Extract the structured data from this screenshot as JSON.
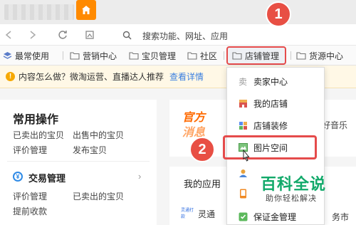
{
  "browser": {
    "address_placeholder": "搜索功能、网址、应用"
  },
  "bookmarks": [
    {
      "label": "最常使用",
      "icon": "layers-icon"
    },
    {
      "label": "营销中心",
      "icon": "folder-icon"
    },
    {
      "label": "宝贝管理",
      "icon": "folder-icon"
    },
    {
      "label": "社区",
      "icon": "folder-icon"
    },
    {
      "label": "店铺管理",
      "icon": "folder-icon"
    },
    {
      "label": "货源中心",
      "icon": "folder-icon"
    }
  ],
  "notice": {
    "text": "内容怎么做？微淘运营、直播达人推荐",
    "link": "查看详情"
  },
  "ops": {
    "title": "常用操作",
    "links": [
      "已卖出的宝贝",
      "出售中的宝贝",
      "评价管理",
      "发布宝贝"
    ]
  },
  "trade": {
    "icon_text": "¥",
    "title": "交易管理",
    "links": [
      "评价管理",
      "已卖出的宝贝",
      "提前收款"
    ]
  },
  "banner": {
    "brand_line1": "官方",
    "brand_line2": "消息",
    "tail": "好音乐"
  },
  "apps": {
    "title": "我的应用",
    "logo_text": "灵通打款",
    "first_app": "灵通",
    "tail": "务市场"
  },
  "dropdown": {
    "items": [
      {
        "label": "卖家中心",
        "icon_text": "卖",
        "icon": "seller-icon"
      },
      {
        "label": "我的店铺",
        "icon": "shop-icon"
      },
      {
        "label": "店铺装修",
        "icon": "decoration-icon"
      },
      {
        "label": "图片空间",
        "icon": "image-icon"
      },
      {
        "label": "",
        "icon": "person-icon"
      },
      {
        "label": "",
        "icon": "phone-icon"
      },
      {
        "label": "保证金管理",
        "icon": "deposit-icon"
      }
    ]
  },
  "steps": [
    "1",
    "2"
  ],
  "watermark": {
    "title": "百科全说",
    "subtitle": "助你轻松解决"
  },
  "colors": {
    "accent_orange": "#ff8a00",
    "highlight_red": "#e54b4b",
    "link_blue": "#3a7fe0",
    "watermark_green": "#12a96a"
  }
}
